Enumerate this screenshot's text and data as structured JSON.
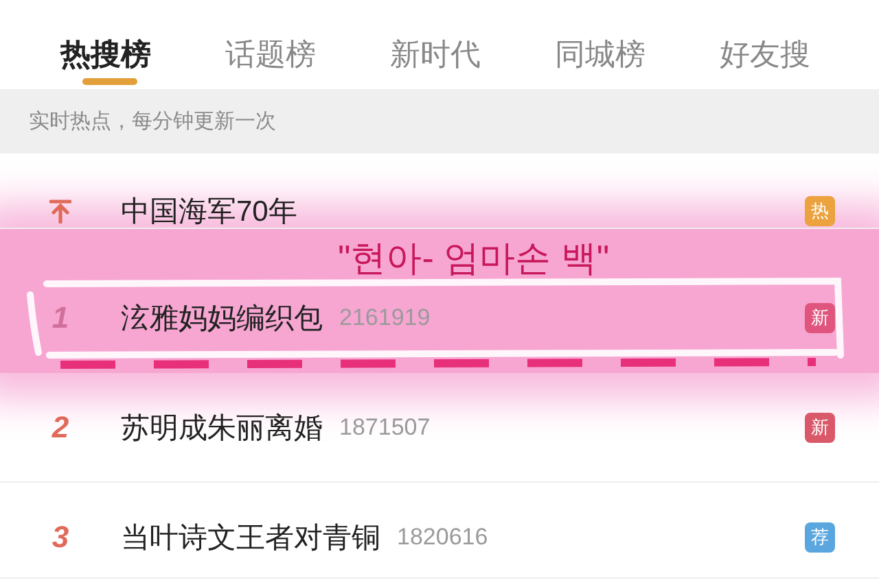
{
  "tabs": [
    {
      "label": "热搜榜",
      "selected": true
    },
    {
      "label": "话题榜",
      "selected": false
    },
    {
      "label": "新时代",
      "selected": false
    },
    {
      "label": "同城榜",
      "selected": false
    },
    {
      "label": "好友搜",
      "selected": false
    }
  ],
  "notice": "实时热点，每分钟更新一次",
  "rows": [
    {
      "kind": "pinned",
      "title": "中国海军70年",
      "highlighted": false,
      "badge": {
        "label": "热",
        "color": "#eba23f"
      }
    },
    {
      "kind": "ranked",
      "rank": "1",
      "title": "泫雅妈妈编织包",
      "count": "2161919",
      "highlighted": true,
      "badge": {
        "label": "新",
        "color": "#e0557e"
      }
    },
    {
      "kind": "ranked",
      "rank": "2",
      "title": "苏明成朱丽离婚",
      "count": "1871507",
      "highlighted": false,
      "badge": {
        "label": "新",
        "color": "#d9596b"
      }
    },
    {
      "kind": "ranked",
      "rank": "3",
      "title": "当叶诗文王者对青铜",
      "count": "1820616",
      "highlighted": false,
      "badge": {
        "label": "荐",
        "color": "#5aa6df"
      }
    }
  ],
  "annotation": {
    "text": "\"현아- 엄마손 백\""
  }
}
